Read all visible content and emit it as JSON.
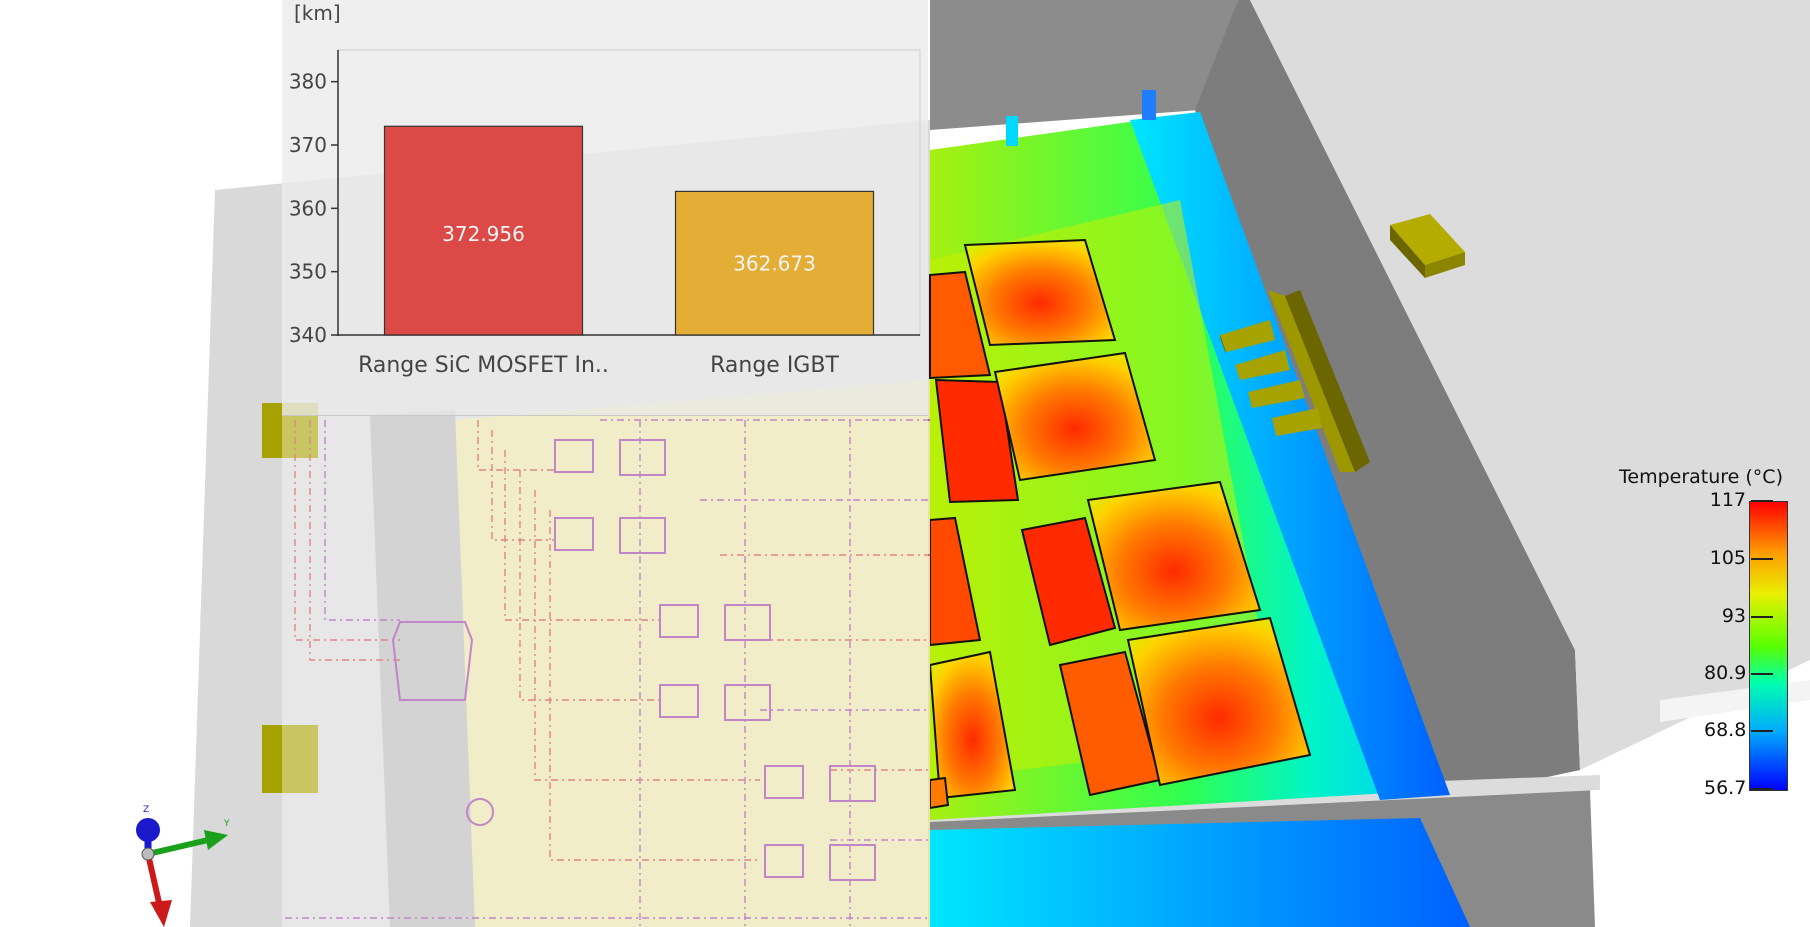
{
  "chart_data": [
    {
      "type": "bar",
      "unit_label": "[km]",
      "categories": [
        "Range SiC MOSFET In..",
        "Range IGBT"
      ],
      "values": [
        372.956,
        362.673
      ],
      "value_labels": [
        "372.956",
        "362.673"
      ],
      "ylim": [
        340,
        385
      ],
      "yticks": [
        340,
        350,
        360,
        370,
        380
      ],
      "bar_colors": [
        "#d8332f",
        "#e3a51d"
      ]
    }
  ],
  "legend": {
    "title": "Temperature (°C)",
    "ticks": [
      "117",
      "105",
      "93",
      "80.9",
      "68.8",
      "56.7"
    ],
    "max": 117,
    "min": 56.7
  },
  "axes_triad": {
    "z": "Z",
    "y": "Y"
  }
}
